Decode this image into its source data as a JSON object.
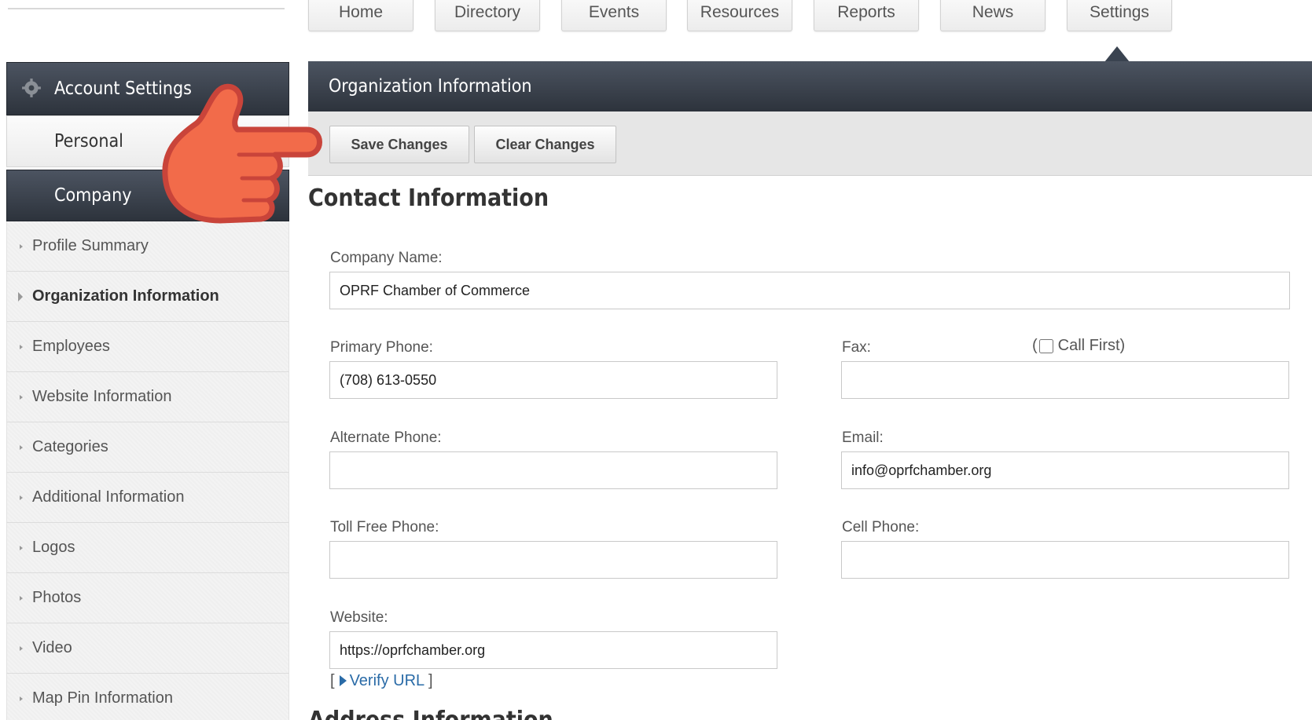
{
  "nav": {
    "tabs": [
      "Home",
      "Directory",
      "Events",
      "Resources",
      "Reports",
      "News",
      "Settings"
    ],
    "active": "Settings"
  },
  "sidebar": {
    "header": "Account Settings",
    "personal": "Personal",
    "company": "Company",
    "items": [
      "Profile Summary",
      "Organization Information",
      "Employees",
      "Website Information",
      "Categories",
      "Additional Information",
      "Logos",
      "Photos",
      "Video",
      "Map Pin Information"
    ],
    "active_item": "Organization Information"
  },
  "main": {
    "title": "Organization Information",
    "save_label": "Save Changes",
    "clear_label": "Clear Changes",
    "contact_title": "Contact Information",
    "address_title": "Address Information"
  },
  "form": {
    "company_name": {
      "label": "Company Name:",
      "value": "OPRF Chamber of Commerce"
    },
    "primary_phone": {
      "label": "Primary Phone:",
      "value": "(708) 613-0550"
    },
    "fax": {
      "label": "Fax:",
      "value": ""
    },
    "call_first": {
      "label": "Call First)",
      "prefix": "("
    },
    "alternate_phone": {
      "label": "Alternate Phone:",
      "value": ""
    },
    "email": {
      "label": "Email:",
      "value": "info@oprfchamber.org"
    },
    "toll_free_phone": {
      "label": "Toll Free Phone:",
      "value": ""
    },
    "cell_phone": {
      "label": "Cell Phone:",
      "value": ""
    },
    "website": {
      "label": "Website:",
      "value": "https://oprfchamber.org"
    },
    "verify_url": {
      "open": "[",
      "label": "Verify URL",
      "close": "]"
    }
  },
  "colors": {
    "header_dark": "#2d333c",
    "link": "#2a6ba7",
    "hand_fill": "#f26b4a",
    "hand_outline": "#c9443a"
  },
  "icons": {
    "settings": "gear-icon",
    "pointer": "pointing-hand-icon"
  }
}
